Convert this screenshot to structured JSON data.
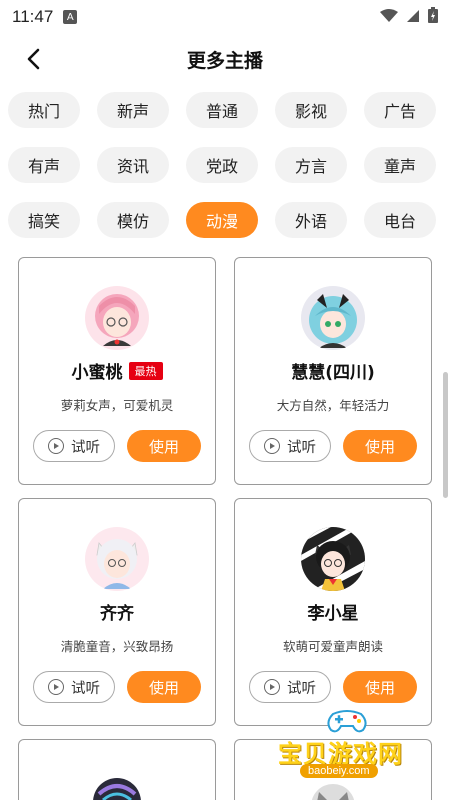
{
  "status": {
    "time": "11:47",
    "notif_badge": "A"
  },
  "header": {
    "title": "更多主播"
  },
  "categories": [
    [
      "热门",
      "新声",
      "普通",
      "影视",
      "广告"
    ],
    [
      "有声",
      "资讯",
      "党政",
      "方言",
      "童声"
    ],
    [
      "搞笑",
      "模仿",
      "动漫",
      "外语",
      "电台"
    ]
  ],
  "active_category": "动漫",
  "cards": [
    {
      "name": "小蜜桃",
      "badge": "最热",
      "desc": "萝莉女声，可爱机灵",
      "listen_label": "试听",
      "use_label": "使用"
    },
    {
      "name": "慧慧(四川)",
      "desc": "大方自然，年轻活力",
      "listen_label": "试听",
      "use_label": "使用"
    },
    {
      "name": "齐齐",
      "desc": "清脆童音，兴致昂扬",
      "listen_label": "试听",
      "use_label": "使用"
    },
    {
      "name": "李小星",
      "desc": "软萌可爱童声朗读",
      "listen_label": "试听",
      "use_label": "使用"
    }
  ],
  "watermark": {
    "text": "宝贝游戏网",
    "url": "baobeiy.com"
  },
  "colors": {
    "accent": "#ff8a1f",
    "badge": "#e60012",
    "chip_bg": "#f2f2f2"
  }
}
